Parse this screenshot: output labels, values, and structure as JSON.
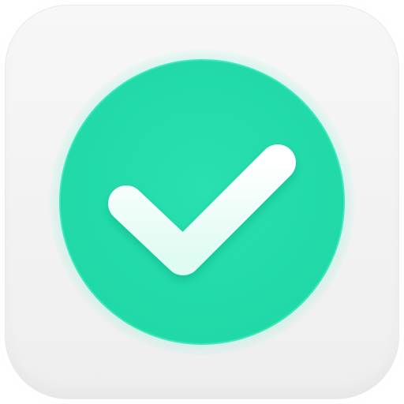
{
  "app_icon": {
    "icon": "checkmark-icon",
    "colors": {
      "tile": "#f2f2f2",
      "circle": "#22dcaa",
      "circle_edge": "#34e7b8",
      "glow": "#3ff0c6",
      "check": "#f4fffb"
    }
  }
}
